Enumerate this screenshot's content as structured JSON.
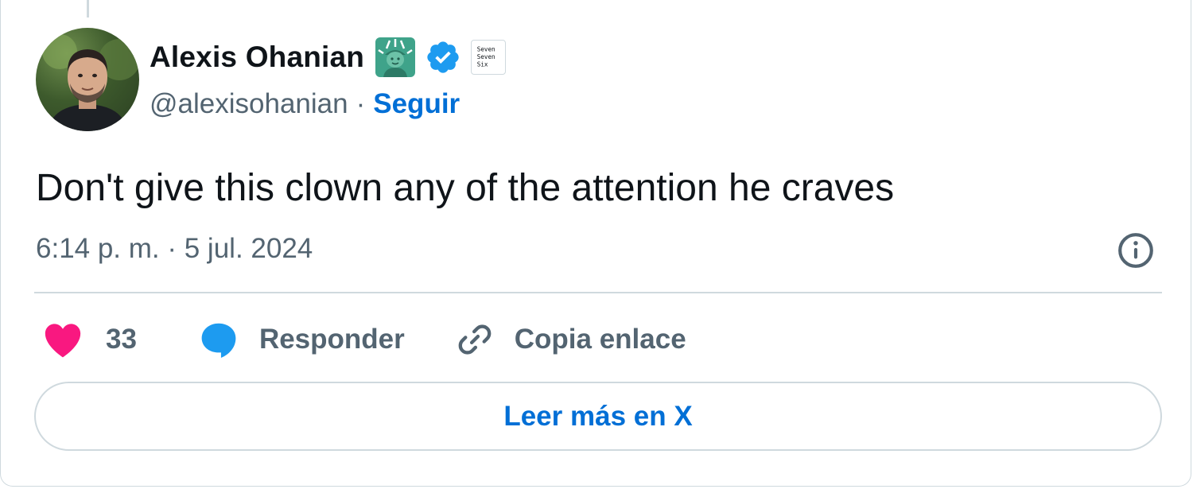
{
  "author": {
    "name": "Alexis Ohanian",
    "handle": "@alexisohanian",
    "separator": "·",
    "follow_label": "Seguir",
    "badges": [
      "statue-of-liberty-emoji",
      "verified-badge",
      "affiliate-badge"
    ],
    "affiliate_badge_text": [
      "Seven",
      "Seven",
      "Six"
    ]
  },
  "tweet": {
    "text": "Don't give this clown any of the attention he craves",
    "timestamp": "6:14 p. m. · 5 jul. 2024"
  },
  "actions": {
    "like_count": "33",
    "reply_label": "Responder",
    "copy_link_label": "Copia enlace"
  },
  "read_more_label": "Leer más en X",
  "icons": {
    "like": "heart-icon",
    "reply": "speech-bubble-icon",
    "copy_link": "link-icon",
    "info": "info-icon",
    "verified": "verified-check-icon"
  },
  "colors": {
    "text_primary": "#0f1419",
    "text_secondary": "#536471",
    "link_blue": "#006fd6",
    "verified_blue": "#1d9bf0",
    "like_pink": "#f91880",
    "border": "#cfd9de"
  }
}
